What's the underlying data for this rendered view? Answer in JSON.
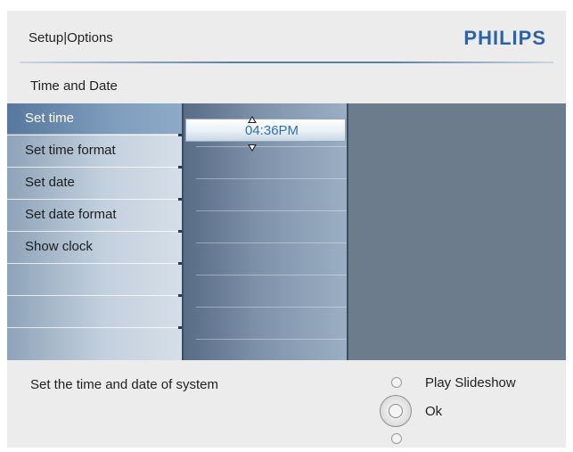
{
  "header": {
    "title": "Setup|Options",
    "brand": "PHILIPS"
  },
  "section": {
    "title": "Time and Date"
  },
  "menu": {
    "items": [
      {
        "label": "Set time",
        "selected": true
      },
      {
        "label": "Set time format"
      },
      {
        "label": "Set date"
      },
      {
        "label": "Set date format"
      },
      {
        "label": "Show clock"
      }
    ]
  },
  "time_spinner": {
    "value": "04:36PM"
  },
  "footer": {
    "help_text": "Set the time and date of system",
    "play_label": "Play Slideshow",
    "ok_label": "Ok"
  },
  "colors": {
    "brand": "#2d63ad",
    "selection": "#6a8cb0",
    "panel": "#6e7f93",
    "spinner_text": "#2d6fb0"
  }
}
